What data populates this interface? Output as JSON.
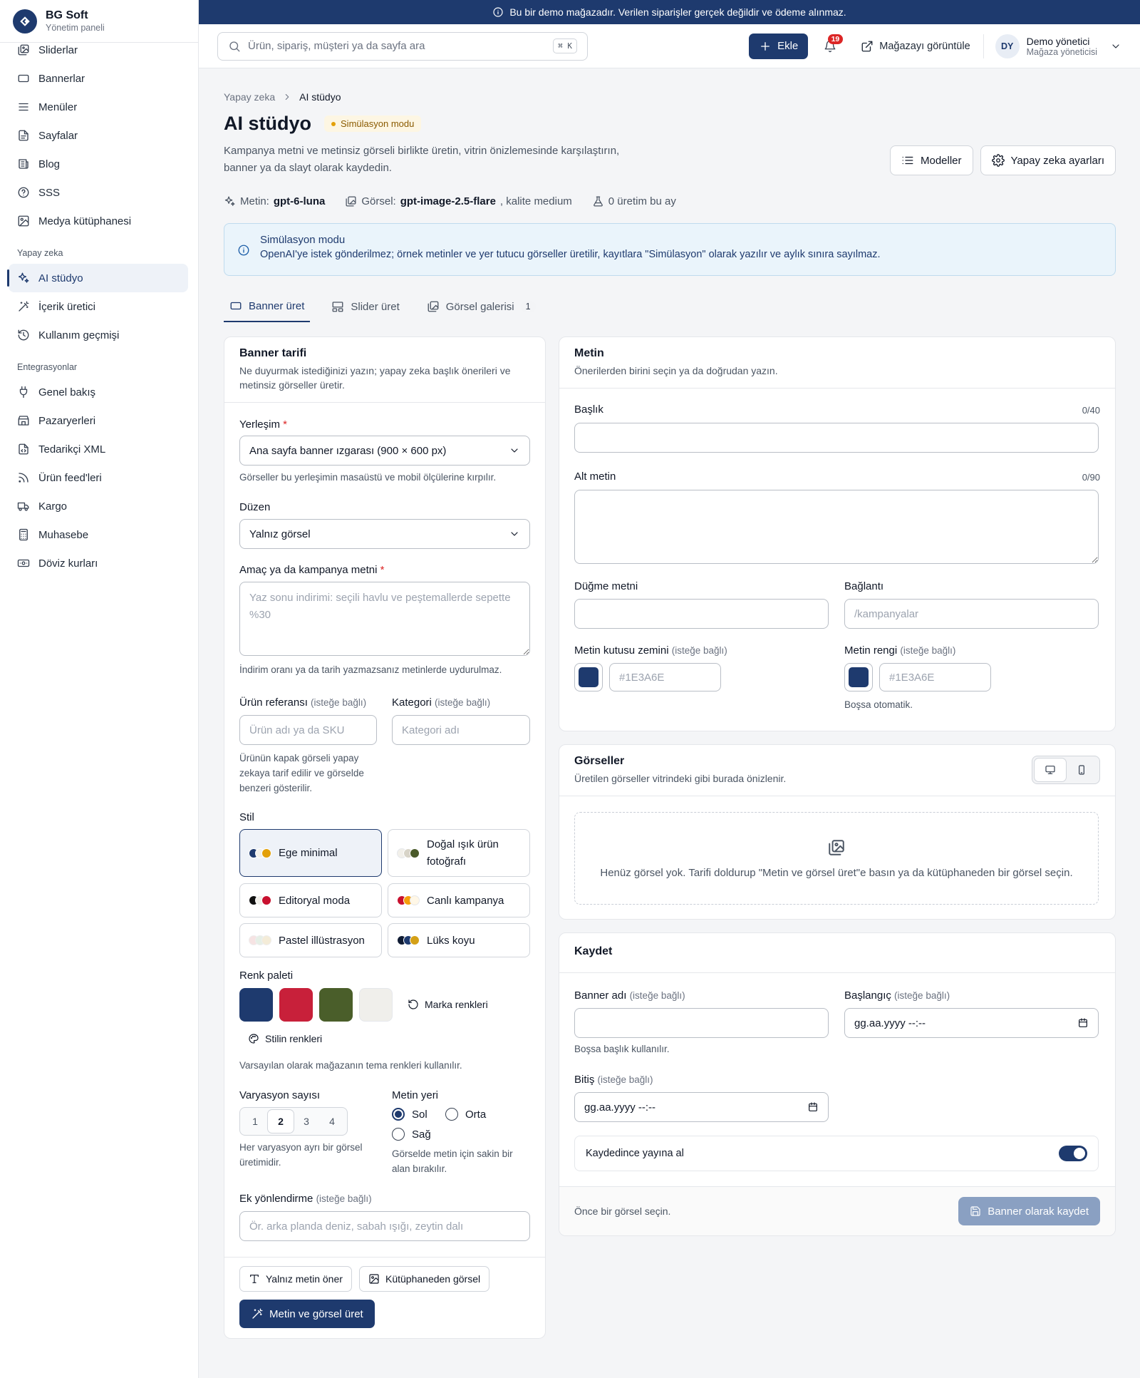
{
  "brand": {
    "name": "BG Soft",
    "subtitle": "Yönetim paneli"
  },
  "sidebar": {
    "items_top": [
      {
        "label": "Sliderlar",
        "icon": "images-icon"
      },
      {
        "label": "Bannerlar",
        "icon": "rectangle-icon"
      },
      {
        "label": "Menüler",
        "icon": "menu-icon"
      },
      {
        "label": "Sayfalar",
        "icon": "file-icon"
      },
      {
        "label": "Blog",
        "icon": "newspaper-icon"
      },
      {
        "label": "SSS",
        "icon": "help-circle-icon"
      },
      {
        "label": "Medya kütüphanesi",
        "icon": "image-icon"
      }
    ],
    "section_ai": "Yapay zeka",
    "items_ai": [
      {
        "label": "AI stüdyo",
        "icon": "sparkles-icon",
        "active": true
      },
      {
        "label": "İçerik üretici",
        "icon": "wand-icon"
      },
      {
        "label": "Kullanım geçmişi",
        "icon": "history-icon"
      }
    ],
    "section_integrations": "Entegrasyonlar",
    "items_integrations": [
      {
        "label": "Genel bakış",
        "icon": "plug-icon"
      },
      {
        "label": "Pazaryerleri",
        "icon": "store-icon"
      },
      {
        "label": "Tedarikçi XML",
        "icon": "file-code-icon"
      },
      {
        "label": "Ürün feed'leri",
        "icon": "rss-icon"
      },
      {
        "label": "Kargo",
        "icon": "truck-icon"
      },
      {
        "label": "Muhasebe",
        "icon": "calculator-icon"
      },
      {
        "label": "Döviz kurları",
        "icon": "banknote-icon"
      }
    ]
  },
  "demo_banner": "Bu bir demo mağazadır. Verilen siparişler gerçek değildir ve ödeme alınmaz.",
  "topbar": {
    "search_placeholder": "Ürün, sipariş, müşteri ya da sayfa ara",
    "search_shortcut": "⌘ K",
    "add_label": "Ekle",
    "notifications_count": "19",
    "view_store_label": "Mağazayı görüntüle",
    "user_initials": "DY",
    "user_name": "Demo yönetici",
    "user_role": "Mağaza yöneticisi"
  },
  "page": {
    "breadcrumb_parent": "Yapay zeka",
    "breadcrumb_current": "AI stüdyo",
    "title": "AI stüdyo",
    "badge": "Simülasyon modu",
    "description": "Kampanya metni ve metinsiz görseli birlikte üretin, vitrin önizlemesinde karşılaştırın, banner ya da slayt olarak kaydedin.",
    "models_button": "Modeller",
    "settings_button": "Yapay zeka ayarları",
    "meta_text_label": "Metin:",
    "meta_text_model": "gpt-6-luna",
    "meta_image_label": "Görsel:",
    "meta_image_model": "gpt-image-2.5-flare",
    "meta_quality": ", kalite medium",
    "meta_usage": "0 üretim bu ay",
    "info_title": "Simülasyon modu",
    "info_text": "OpenAI'ye istek gönderilmez; örnek metinler ve yer tutucu görseller üretilir, kayıtlara \"Simülasyon\" olarak yazılır ve aylık sınıra sayılmaz.",
    "tabs": [
      {
        "label": "Banner üret",
        "active": true
      },
      {
        "label": "Slider üret"
      },
      {
        "label": "Görsel galerisi",
        "count": "1"
      }
    ]
  },
  "brief": {
    "title": "Banner tarifi",
    "subtitle": "Ne duyurmak istediğinizi yazın; yapay zeka başlık önerileri ve metinsiz görseller üretir.",
    "placement_label": "Yerleşim",
    "placement_value": "Ana sayfa banner ızgarası (900 × 600 px)",
    "placement_help": "Görseller bu yerleşimin masaüstü ve mobil ölçülerine kırpılır.",
    "layout_label": "Düzen",
    "layout_value": "Yalnız görsel",
    "goal_label": "Amaç ya da kampanya metni",
    "goal_placeholder": "Yaz sonu indirimi: seçili havlu ve peştemallerde sepette %30",
    "goal_help": "İndirim oranı ya da tarih yazmazsanız metinlerde uydurulmaz.",
    "product_label": "Ürün referansı",
    "category_label": "Kategori",
    "optional": "(isteğe bağlı)",
    "product_placeholder": "Ürün adı ya da SKU",
    "category_placeholder": "Kategori adı",
    "product_help": "Ürünün kapak görseli yapay zekaya tarif edilir ve görselde benzeri gösterilir.",
    "style_label": "Stil",
    "styles": [
      {
        "label": "Ege minimal",
        "colors": [
          "#1e3a6e",
          "#f2f0ea",
          "#e3a008"
        ],
        "active": true
      },
      {
        "label": "Doğal ışık ürün fotoğrafı",
        "colors": [
          "#f2f0ea",
          "#d8d4c8",
          "#4a5a2a"
        ]
      },
      {
        "label": "Editoryal moda",
        "colors": [
          "#111111",
          "#f2f0ea",
          "#c8102e"
        ]
      },
      {
        "label": "Canlı kampanya",
        "colors": [
          "#c8102e",
          "#f59e0b",
          "#fff7e6"
        ]
      },
      {
        "label": "Pastel illüstrasyon",
        "colors": [
          "#f6e3e3",
          "#e6efe6",
          "#f4ecd8"
        ]
      },
      {
        "label": "Lüks koyu",
        "colors": [
          "#0f1b33",
          "#1e3a6e",
          "#d4a017"
        ]
      }
    ],
    "palette_label": "Renk paleti",
    "palette": [
      "#1e3a6e",
      "#c8203a",
      "#4a5e2a",
      "#f0efeb"
    ],
    "brand_colors_label": "Marka renkleri",
    "style_colors_label": "Stilin renkleri",
    "palette_help": "Varsayılan olarak mağazanın tema renkleri kullanılır.",
    "variation_label": "Varyasyon sayısı",
    "variations": [
      "1",
      "2",
      "3",
      "4"
    ],
    "variation_selected": 1,
    "variation_help": "Her varyasyon ayrı bir görsel üretimidir.",
    "text_position_label": "Metin yeri",
    "pos_left": "Sol",
    "pos_center": "Orta",
    "pos_right": "Sağ",
    "text_position_help": "Görselde metin için sakin bir alan bırakılır.",
    "extra_label": "Ek yönlendirme",
    "extra_placeholder": "Ör. arka planda deniz, sabah ışığı, zeytin dalı",
    "text_only_button": "Yalnız metin öner",
    "library_button": "Kütüphaneden görsel",
    "generate_button": "Metin ve görsel üret"
  },
  "text_card": {
    "title": "Metin",
    "subtitle": "Önerilerden birini seçin ya da doğrudan yazın.",
    "headline_label": "Başlık",
    "headline_counter": "0/40",
    "subtext_label": "Alt metin",
    "subtext_counter": "0/90",
    "button_text_label": "Düğme metni",
    "link_label": "Bağlantı",
    "link_placeholder": "/kampanyalar",
    "box_bg_label": "Metin kutusu zemini",
    "text_color_label": "Metin rengi",
    "optional": "(isteğe bağlı)",
    "box_bg_placeholder": "#1E3A6E",
    "text_color_placeholder": "#1E3A6E",
    "swatch_color": "#1e3a6e",
    "auto_help": "Boşsa otomatik."
  },
  "images_card": {
    "title": "Görseller",
    "subtitle": "Üretilen görseller vitrindeki gibi burada önizlenir.",
    "empty_text": "Henüz görsel yok. Tarifi doldurup \"Metin ve görsel üret\"e basın ya da kütüphaneden bir görsel seçin."
  },
  "save_card": {
    "title": "Kaydet",
    "name_label": "Banner adı",
    "start_label": "Başlangıç",
    "end_label": "Bitiş",
    "optional": "(isteğe bağlı)",
    "date_placeholder": "gg.aa.yyyy --:--",
    "name_help": "Boşsa başlık kullanılır.",
    "publish_label": "Kaydedince yayına al",
    "footer_hint": "Önce bir görsel seçin.",
    "save_button": "Banner olarak kaydet"
  }
}
